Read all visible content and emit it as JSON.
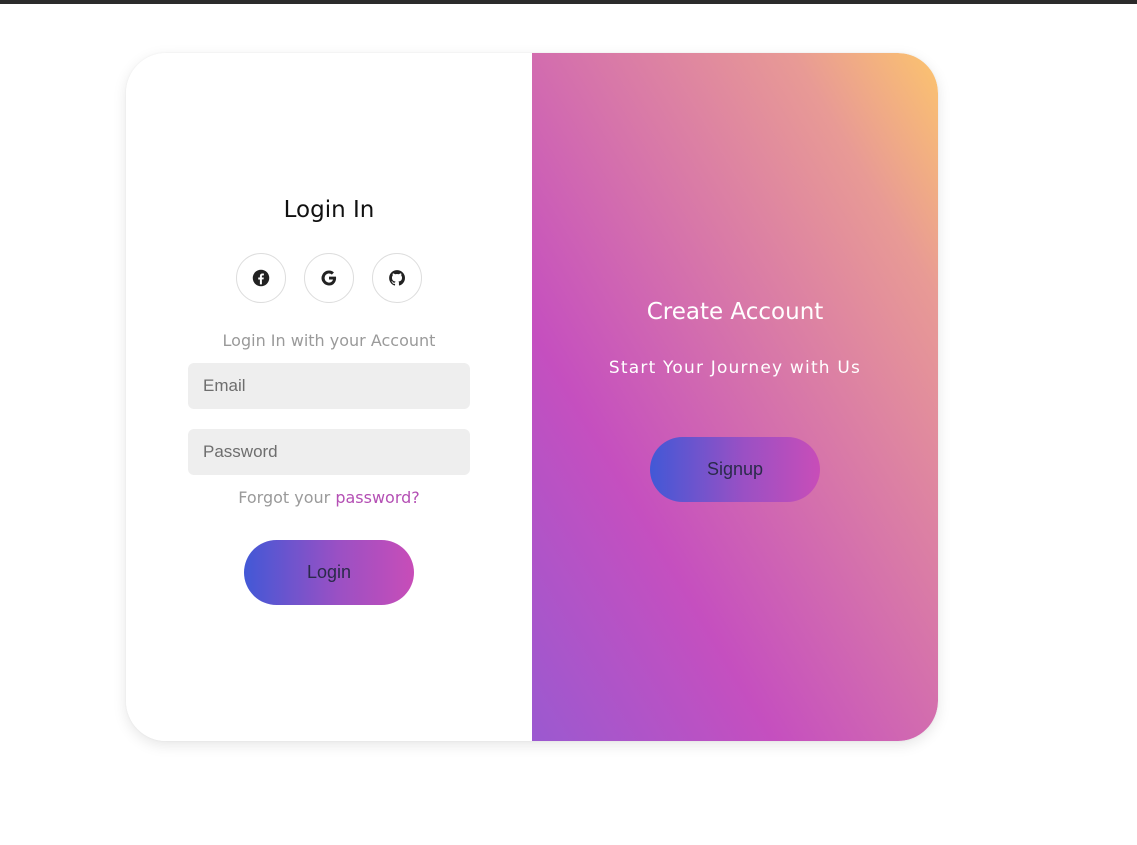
{
  "login": {
    "title": "Login In",
    "social": [
      {
        "icon": "facebook-icon"
      },
      {
        "icon": "google-icon"
      },
      {
        "icon": "github-icon"
      }
    ],
    "subtitle": "Login In with your Account",
    "email_placeholder": "Email",
    "email_value": "",
    "password_placeholder": "Password",
    "password_value": "",
    "forgot_text": "Forgot your",
    "forgot_link": "password?",
    "button_label": "Login"
  },
  "signup": {
    "title": "Create Account",
    "subtitle": "Start Your Journey with Us",
    "button_label": "Signup"
  },
  "colors": {
    "accent_link": "#b44fb4",
    "button_gradient_start": "#4258d6",
    "button_gradient_end": "#c84db8",
    "panel_gradient_bottom_left": "#9b59d0",
    "panel_gradient_top_right": "#fcc46e"
  }
}
